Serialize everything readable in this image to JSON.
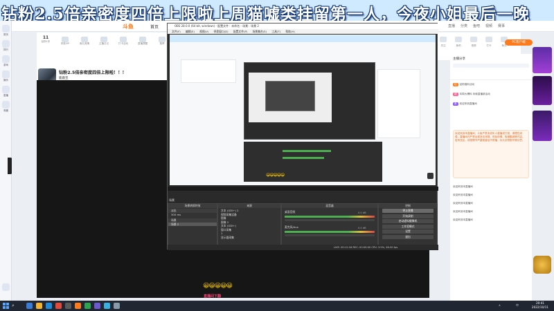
{
  "banner": {
    "text": "钻粉2.5倍亲密度四倍上限啦上周猫嘘类挂留第一人，今夜小姐最后一晚"
  },
  "left_sidebar": {
    "items": [
      "首页",
      "排行",
      "游戏",
      "娱乐",
      "直播",
      "收藏"
    ]
  },
  "site": {
    "logo": "斗鱼",
    "home": "首页",
    "nav": [
      "直播",
      "分类",
      "鱼吧",
      "视频",
      "赛事"
    ]
  },
  "room": {
    "header_icons": [
      {
        "num": "11",
        "label": "钻粉1折"
      },
      {
        "num": "",
        "label": "贵族VIP"
      },
      {
        "num": "",
        "label": "鱼丸竞猜"
      },
      {
        "num": "",
        "label": "主播日记"
      },
      {
        "num": "",
        "label": "打卡活动"
      },
      {
        "num": "",
        "label": "直播提醒"
      },
      {
        "num": "",
        "label": "推荐"
      }
    ],
    "title": "钻粉2.5倍亲密度四倍上限啦！！！",
    "anchor": "鹿鹿宝",
    "badges": [
      "已关注",
      "主播收藏",
      "直播提醒",
      "粉丝团"
    ],
    "badge_colors": [
      "#ff7a1a",
      "#ff5e91",
      "#8a5cff",
      "#f5a623"
    ]
  },
  "right_header": {
    "icons": [
      "关注",
      "鱼吧",
      "视频",
      "打卡",
      "鱼丸",
      "分享"
    ],
    "pc_button": "PC客户端"
  },
  "obs": {
    "title": "OBS 28.0.0 (64 bit, windows) - 配置文件：未命名 - 场景：场景 2",
    "menu": [
      "文件(F)",
      "编辑(E)",
      "视图(V)",
      "停靠窗口(D)",
      "配置文件(P)",
      "场景集合(S)",
      "工具(T)",
      "帮助(H)"
    ],
    "scenes_title": "场景",
    "sources_title": "来源",
    "mixer_title": "混音器",
    "transitions_title": "场景转换特效",
    "controls_title": "控制",
    "scenes": [
      "场景",
      "场景 2"
    ],
    "sources": [
      "文本 (GDI+) 2",
      "视频采集设备",
      "图像",
      "图像 2",
      "文本 (GDI+)",
      "窗口采集",
      "1",
      "显示器采集"
    ],
    "mixer": [
      "桌面音频",
      "麦克风/Aux"
    ],
    "mixer_db": [
      "0.0 dB",
      "0.0 dB"
    ],
    "transition_fade": "淡出",
    "transition_duration": "300 ms",
    "controls": [
      "停止直播",
      "开始录制",
      "启动虚拟摄像机",
      "工作室模式",
      "设置",
      "退出"
    ],
    "status": "LIVE: 00:12:34   REC: 00:00:00   CPU: 3.9%, 60.00 fps"
  },
  "chat": {
    "header_title": "主播分享",
    "rows": [
      {
        "tag": "钻",
        "tag_color": "#ff7a1a",
        "text": "钻粉福利活动"
      },
      {
        "tag": "超",
        "tag_color": "#ff5e91",
        "text": "本周大爆料  玩转直播新活动"
      },
      {
        "tag": "贵",
        "tag_color": "#8a5cff",
        "text": "欢迎来到直播间"
      }
    ],
    "gift_text": "欢迎来到本直播间，斗鱼严禁未成年人直播或打赏，请理性消费。直播间内严禁出现违法违规、低俗色情、吸烟酗酒等内容，若有违反，将视情节严重程度给予禁播、永久封禁账号等处罚。",
    "bottom_rows": [
      "欢迎来到本直播间",
      "欢迎来到本直播间",
      "欢迎来到本直播间",
      "欢迎来到本直播间",
      "欢迎来到本直播间"
    ]
  },
  "overlays": {
    "emoji": "😀😀😀😀😀",
    "caption": "直播间下翻"
  },
  "taskbar": {
    "search": "搜索",
    "clock_time": "20:41",
    "clock_date": "2022/10/11",
    "tray": [
      "中",
      "∧"
    ]
  }
}
